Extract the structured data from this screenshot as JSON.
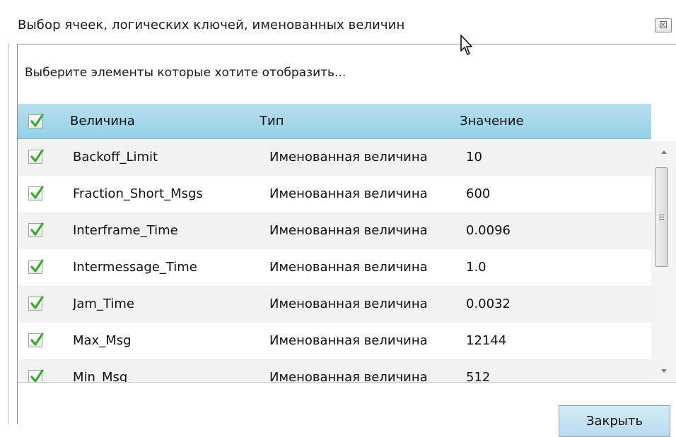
{
  "window": {
    "title": "Выбор ячеек, логических ключей, именованных величин"
  },
  "subtitle": "Выберите элементы которые хотите отобразить...",
  "table": {
    "columns": [
      "Величина",
      "Тип",
      "Значение"
    ],
    "rows": [
      {
        "name": "Backoff_Limit",
        "type": "Именованная величина",
        "value": "10",
        "checked": true
      },
      {
        "name": "Fraction_Short_Msgs",
        "type": "Именованная величина",
        "value": "600",
        "checked": true
      },
      {
        "name": "Interframe_Time",
        "type": "Именованная величина",
        "value": "0.0096",
        "checked": true
      },
      {
        "name": "Intermessage_Time",
        "type": "Именованная величина",
        "value": "1.0",
        "checked": true
      },
      {
        "name": "Jam_Time",
        "type": "Именованная величина",
        "value": "0.0032",
        "checked": true
      },
      {
        "name": "Max_Msg",
        "type": "Именованная величина",
        "value": "12144",
        "checked": true
      },
      {
        "name": "Min_Msg",
        "type": "Именованная величина",
        "value": "512",
        "checked": true
      }
    ]
  },
  "footer": {
    "close_label": "Закрыть"
  },
  "colors": {
    "header_bg": "#a7d8ec",
    "button_bg": "#c6e5f6",
    "check_green": "#3fa82f"
  },
  "icons": {
    "close": "close-icon",
    "check": "checkmark-icon",
    "cursor": "mouse-pointer-icon"
  }
}
